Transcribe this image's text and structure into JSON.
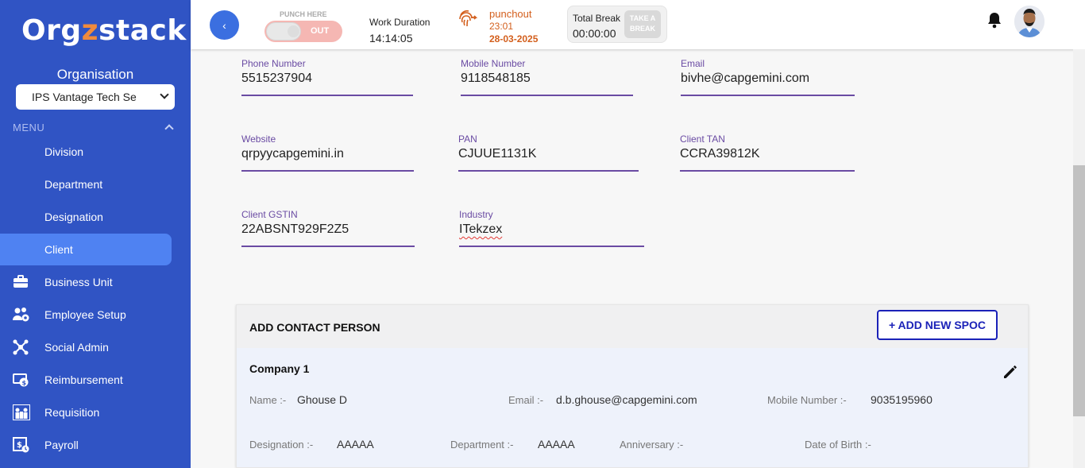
{
  "sidebar": {
    "logo_prefix": "Org",
    "logo_accent": "z",
    "logo_suffix": "stack",
    "org_title": "Organisation",
    "org_selected": "IPS Vantage Tech Se",
    "menu_label": "MENU",
    "items": [
      {
        "label": "Division",
        "icon": ""
      },
      {
        "label": "Department",
        "icon": ""
      },
      {
        "label": "Designation",
        "icon": ""
      },
      {
        "label": "Client",
        "icon": "",
        "active": true
      },
      {
        "label": "Business Unit",
        "icon": "briefcase-icon"
      },
      {
        "label": "Employee Setup",
        "icon": "users-gear-icon"
      },
      {
        "label": "Social Admin",
        "icon": "network-icon"
      },
      {
        "label": "Reimbursement",
        "icon": "money-icon"
      },
      {
        "label": "Requisition",
        "icon": "people-group-icon"
      },
      {
        "label": "Payroll",
        "icon": "payroll-icon"
      }
    ]
  },
  "topbar": {
    "back_glyph": "‹",
    "punch_here": "PUNCH HERE",
    "punch_state": "OUT",
    "work_duration_label": "Work Duration",
    "work_duration_value": "14:14:05",
    "punchout_label": "punchout",
    "punchout_time": "23:01",
    "punchout_date": "28-03-2025",
    "total_break_label": "Total Break",
    "total_break_value": "00:00:00",
    "take_break_line1": "TAKE A",
    "take_break_line2": "BREAK"
  },
  "form": {
    "phone": {
      "label": "Phone Number",
      "value": "5515237904"
    },
    "mobile": {
      "label": "Mobile Number",
      "value": "9118548185"
    },
    "email": {
      "label": "Email",
      "value": "bivhe@capgemini.com"
    },
    "website": {
      "label": "Website",
      "value": "qrpyycapgemini.in"
    },
    "pan": {
      "label": "PAN",
      "value": "CJUUE1131K"
    },
    "tan": {
      "label": "Client TAN",
      "value": "CCRA39812K"
    },
    "gstin": {
      "label": "Client GSTIN",
      "value": "22ABSNT929F2Z5"
    },
    "industry": {
      "label": "Industry",
      "value": "ITekzex"
    }
  },
  "contact": {
    "title": "ADD CONTACT PERSON",
    "add_button": "+ ADD NEW SPOC",
    "company": {
      "name": "Company 1",
      "name_label": "Name :-",
      "name_value": "Ghouse D",
      "email_label": "Email :-",
      "email_value": "d.b.ghouse@capgemini.com",
      "mobile_label": "Mobile Number :-",
      "mobile_value": "9035195960",
      "designation_label": "Designation :-",
      "designation_value": "AAAAA",
      "department_label": "Department :-",
      "department_value": "AAAAA",
      "anniversary_label": "Anniversary :-",
      "dob_label": "Date of Birth :-"
    }
  },
  "colors": {
    "sidebar_bg": "#3054c4",
    "active_item": "#4f82f2",
    "accent_purple": "#6a4ba3",
    "punchout_orange": "#d35f1d",
    "spoc_blue": "#1b22b8"
  }
}
